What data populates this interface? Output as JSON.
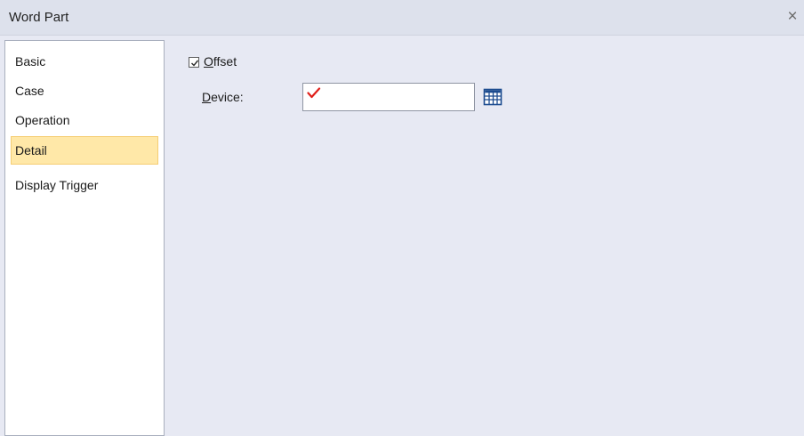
{
  "window": {
    "title": "Word Part",
    "close_glyph": "×"
  },
  "sidebar": {
    "items": [
      {
        "label": "Basic",
        "selected": false
      },
      {
        "label": "Case",
        "selected": false
      },
      {
        "label": "Operation",
        "selected": false
      },
      {
        "label": "Detail",
        "selected": true
      },
      {
        "label": "Display Trigger",
        "selected": false
      }
    ]
  },
  "detail": {
    "offset": {
      "accel": "O",
      "label_rest": "ffset",
      "checked": true
    },
    "device": {
      "accel": "D",
      "label_rest": "evice:",
      "value": "",
      "invalid_icon": "red-checkmark-icon",
      "picker_icon": "device-picker-grid-icon"
    }
  },
  "colors": {
    "selected_item_bg": "#ffe8a8",
    "selected_item_border": "#f5cd74",
    "panel_bg": "#e7e9f3",
    "invalid_mark": "#e0201b",
    "picker_icon": "#1c4b8f"
  }
}
